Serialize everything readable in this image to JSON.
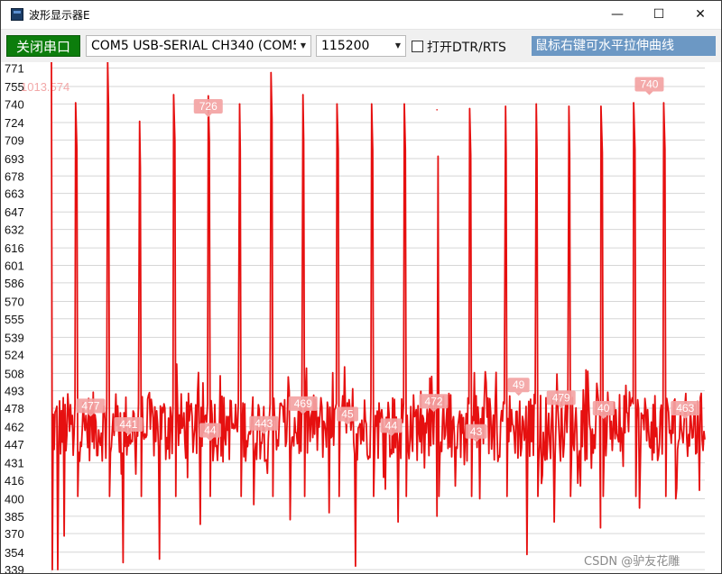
{
  "window": {
    "title": "波形显示器E",
    "minimize": "—",
    "maximize": "☐",
    "close": "✕"
  },
  "toolbar": {
    "serial_button_label": "关闭串口",
    "port_value": "COM5 USB-SERIAL CH340 (COM5)",
    "baud_value": "115200",
    "dtr_rts_label": "打开DTR/RTS",
    "dtr_rts_checked": false,
    "hint_text": "鼠标右键可水平拉伸曲线"
  },
  "colors": {
    "series": "#e61010",
    "peak_label_bg": "#f3a3a3",
    "serial_button": "#0c7d0c",
    "hint_bg": "#6c98c4"
  },
  "watermark": "CSDN @驴友花雕",
  "chart_data": {
    "type": "line",
    "y_ticks": [
      771,
      755,
      740,
      724,
      709,
      693,
      678,
      663,
      647,
      632,
      616,
      601,
      586,
      570,
      555,
      539,
      524,
      508,
      493,
      478,
      462,
      447,
      431,
      416,
      400,
      385,
      370,
      354,
      339
    ],
    "ylim": [
      336,
      776
    ],
    "grid": true,
    "overlay_value": "1013.574",
    "peak_labels": [
      {
        "text": "726",
        "x": 0.24,
        "y": 738
      },
      {
        "text": "740",
        "x": 0.915,
        "y": 757
      },
      {
        "text": "477",
        "x": 0.06,
        "y": 480
      },
      {
        "text": "441",
        "x": 0.118,
        "y": 464
      },
      {
        "text": "44",
        "x": 0.243,
        "y": 459
      },
      {
        "text": "443",
        "x": 0.325,
        "y": 465
      },
      {
        "text": "469",
        "x": 0.385,
        "y": 482
      },
      {
        "text": "45",
        "x": 0.453,
        "y": 473
      },
      {
        "text": "44",
        "x": 0.52,
        "y": 463
      },
      {
        "text": "472",
        "x": 0.585,
        "y": 484
      },
      {
        "text": "43",
        "x": 0.65,
        "y": 458
      },
      {
        "text": "49",
        "x": 0.715,
        "y": 498
      },
      {
        "text": "479",
        "x": 0.78,
        "y": 487
      },
      {
        "text": "40",
        "x": 0.845,
        "y": 478
      },
      {
        "text": "463",
        "x": 0.97,
        "y": 478
      }
    ],
    "series": [
      {
        "peaks": [
          {
            "x": 0.037,
            "v": 741
          },
          {
            "x": 0.086,
            "v": 776
          },
          {
            "x": 0.135,
            "v": 725
          },
          {
            "x": 0.187,
            "v": 748
          },
          {
            "x": 0.24,
            "v": 747
          },
          {
            "x": 0.288,
            "v": 740
          },
          {
            "x": 0.336,
            "v": 767
          },
          {
            "x": 0.385,
            "v": 748
          },
          {
            "x": 0.437,
            "v": 740
          },
          {
            "x": 0.49,
            "v": 740
          },
          {
            "x": 0.54,
            "v": 740
          },
          {
            "x": 0.59,
            "v": 735
          },
          {
            "x": 0.64,
            "v": 736
          },
          {
            "x": 0.695,
            "v": 738
          },
          {
            "x": 0.742,
            "v": 740
          },
          {
            "x": 0.792,
            "v": 738
          },
          {
            "x": 0.841,
            "v": 738
          },
          {
            "x": 0.891,
            "v": 741
          },
          {
            "x": 0.937,
            "v": 741
          }
        ],
        "baseline": 462,
        "deep_dips": [
          {
            "x": 0.01,
            "v": 339
          },
          {
            "x": 0.02,
            "v": 368
          },
          {
            "x": 0.11,
            "v": 345
          },
          {
            "x": 0.165,
            "v": 348
          },
          {
            "x": 0.228,
            "v": 378
          },
          {
            "x": 0.31,
            "v": 395
          },
          {
            "x": 0.365,
            "v": 382
          },
          {
            "x": 0.425,
            "v": 388
          },
          {
            "x": 0.465,
            "v": 342
          },
          {
            "x": 0.53,
            "v": 380
          },
          {
            "x": 0.59,
            "v": 385
          },
          {
            "x": 0.655,
            "v": 400
          },
          {
            "x": 0.728,
            "v": 352
          },
          {
            "x": 0.77,
            "v": 380
          },
          {
            "x": 0.84,
            "v": 375
          },
          {
            "x": 0.9,
            "v": 392
          },
          {
            "x": 0.955,
            "v": 400
          }
        ]
      }
    ]
  }
}
